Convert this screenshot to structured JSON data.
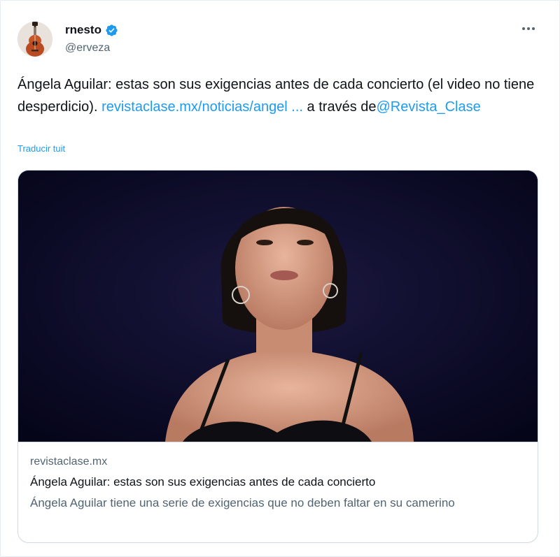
{
  "author": {
    "name": "rnesto",
    "handle": "@erveza",
    "verified": true,
    "avatar_icon": "guitar-avatar"
  },
  "menu": {
    "icon": "more-horizontal-icon",
    "label": "···"
  },
  "tweet": {
    "text_part1": "Ángela Aguilar: estas son sus exigencias antes de cada concierto (el video no tiene desperdicio).",
    "link_url": "revistaclase.mx/noticias/angel ...",
    "text_part2": "a través de",
    "mention": "@Revista_Clase",
    "translate_label": "Traducir tuit"
  },
  "card": {
    "domain": "revistaclase.mx",
    "title": "Ángela Aguilar: estas son sus exigencias antes de cada concierto",
    "description": "Ángela Aguilar tiene una serie de exigencias que no deben faltar en su camerino"
  },
  "colors": {
    "accent": "#1d9bf0",
    "text": "#0f1419",
    "secondary": "#536471",
    "border": "#cfd9de"
  }
}
